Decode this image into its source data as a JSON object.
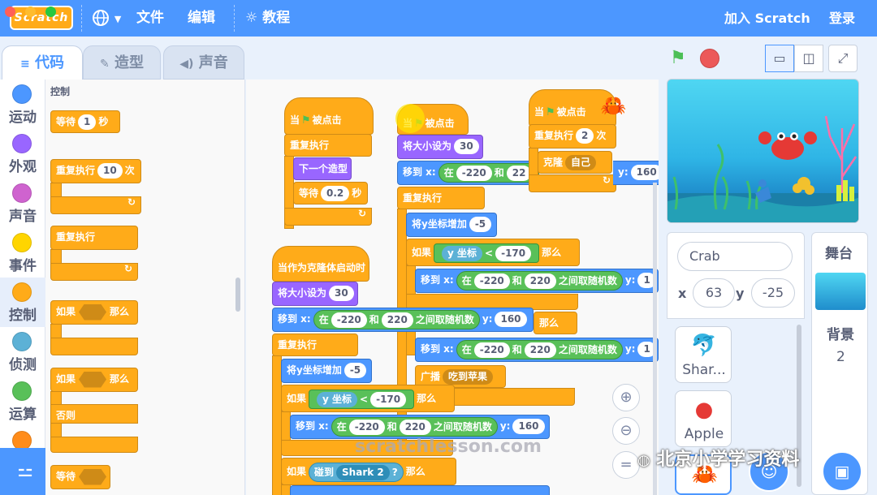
{
  "window": {
    "logo_text": "Scratch",
    "dot_colors": [
      "#ff5f57",
      "#febc2e",
      "#28c840"
    ]
  },
  "menu": {
    "file": "文件",
    "edit": "编辑",
    "tutorials": "教程",
    "join": "加入 Scratch",
    "signin": "登录",
    "globe_icon": "globe-icon",
    "dropdown_icon": "chevron-down-icon",
    "bulb_icon": "lightbulb-icon"
  },
  "tabs": [
    {
      "label": "代码",
      "icon": "code-icon",
      "active": true
    },
    {
      "label": "造型",
      "icon": "brush-icon",
      "active": false
    },
    {
      "label": "声音",
      "icon": "speaker-icon",
      "active": false
    }
  ],
  "categories": [
    {
      "label": "运动",
      "color": "#4c97ff"
    },
    {
      "label": "外观",
      "color": "#9966ff"
    },
    {
      "label": "声音",
      "color": "#cf63cf"
    },
    {
      "label": "事件",
      "color": "#ffd500"
    },
    {
      "label": "控制",
      "color": "#ffab19"
    },
    {
      "label": "侦测",
      "color": "#5cb1d6"
    },
    {
      "label": "运算",
      "color": "#59c059"
    },
    {
      "label": "",
      "color": "#ff8c1a"
    }
  ],
  "palette": {
    "section_title": "控制",
    "wait": {
      "label": "等待",
      "value": "1",
      "unit": "秒"
    },
    "repeat": {
      "label": "重复执行",
      "value": "10",
      "unit": "次"
    },
    "forever": {
      "label": "重复执行"
    },
    "if_then": {
      "label": "如果",
      "then": "那么"
    },
    "if_else": {
      "label": "如果",
      "then": "那么",
      "else": "否则"
    },
    "wait_until": {
      "label": "等待"
    }
  },
  "scripts": {
    "s1": {
      "hat": "当",
      "hat_tail": "被点击",
      "forever": "重复执行",
      "next_costume": "下一个造型",
      "wait": "等待",
      "wait_value": "0.2",
      "wait_unit": "秒"
    },
    "s2": {
      "hat": "当",
      "hat_tail": "被点击",
      "size": "将大小设为",
      "size_value": "30",
      "goto": "移到 x:",
      "rand": "在",
      "rand_from": "-220",
      "rand_and": "和",
      "rand_to": "22",
      "y_label": "y:",
      "y_value": "160",
      "forever": "重复执行",
      "change_y": "将y坐标增加",
      "change_y_value": "-5",
      "if": "如果",
      "ycoord": "y 坐标",
      "lt": "<",
      "cmp_value": "-170",
      "then": "那么",
      "goto2": "移到 x:",
      "rand2": "在",
      "rand2_from": "-220",
      "rand2_and": "和",
      "rand2_to": "220",
      "rand2_tail": "之间取随机数",
      "y2": "y:",
      "y2_value": "1",
      "then2": "那么",
      "goto3": "移到 x:",
      "rand3": "在",
      "rand3_from": "-220",
      "rand3_and": "和",
      "rand3_to": "220",
      "rand3_tail": "之间取随机数",
      "y3": "y:",
      "y3_value": "1",
      "broadcast": "广播",
      "broadcast_msg": "吃到苹果"
    },
    "s3": {
      "hat": "当",
      "hat_tail": "被点击",
      "repeat": "重复执行",
      "repeat_value": "2",
      "repeat_unit": "次",
      "clone": "克隆",
      "clone_target": "自己",
      "y_label": "y:",
      "y_value": "160"
    },
    "s4": {
      "hat": "当作为克隆体启动时",
      "size": "将大小设为",
      "size_value": "30",
      "goto": "移到 x:",
      "rand": "在",
      "rand_from": "-220",
      "rand_and": "和",
      "rand_to": "220",
      "rand_tail": "之间取随机数",
      "y_label": "y:",
      "y_value": "160",
      "forever": "重复执行",
      "change_y": "将y坐标增加",
      "change_y_value": "-5",
      "if": "如果",
      "ycoord": "y 坐标",
      "lt": "<",
      "cmp_value": "-170",
      "then": "那么",
      "goto2": "移到 x:",
      "rand2": "在",
      "rand2_from": "-220",
      "rand2_and": "和",
      "rand2_to": "220",
      "rand2_tail": "之间取随机数",
      "y2": "y:",
      "y2_value": "160",
      "if2": "如果",
      "touching": "碰到",
      "touching_target": "Shark 2",
      "q": "?",
      "then2": "那么"
    }
  },
  "watermark": "scratchlesson.com",
  "zoom": {
    "in_icon": "zoom-in-icon",
    "out_icon": "zoom-out-icon",
    "reset": "="
  },
  "stage_controls": {
    "flag_icon": "green-flag-icon",
    "stop_icon": "stop-icon"
  },
  "sprite_info": {
    "name": "Crab",
    "x_label": "x",
    "x_value": "63",
    "y_label": "y",
    "y_value": "-25"
  },
  "sprites": [
    {
      "name": "Shar...",
      "icon": "shark-icon"
    },
    {
      "name": "Apple",
      "icon": "apple-icon"
    }
  ],
  "stage_panel": {
    "title": "舞台",
    "backdrops_label": "背景",
    "backdrops_count": "2"
  },
  "overlay_text": "北京小学学习资料"
}
